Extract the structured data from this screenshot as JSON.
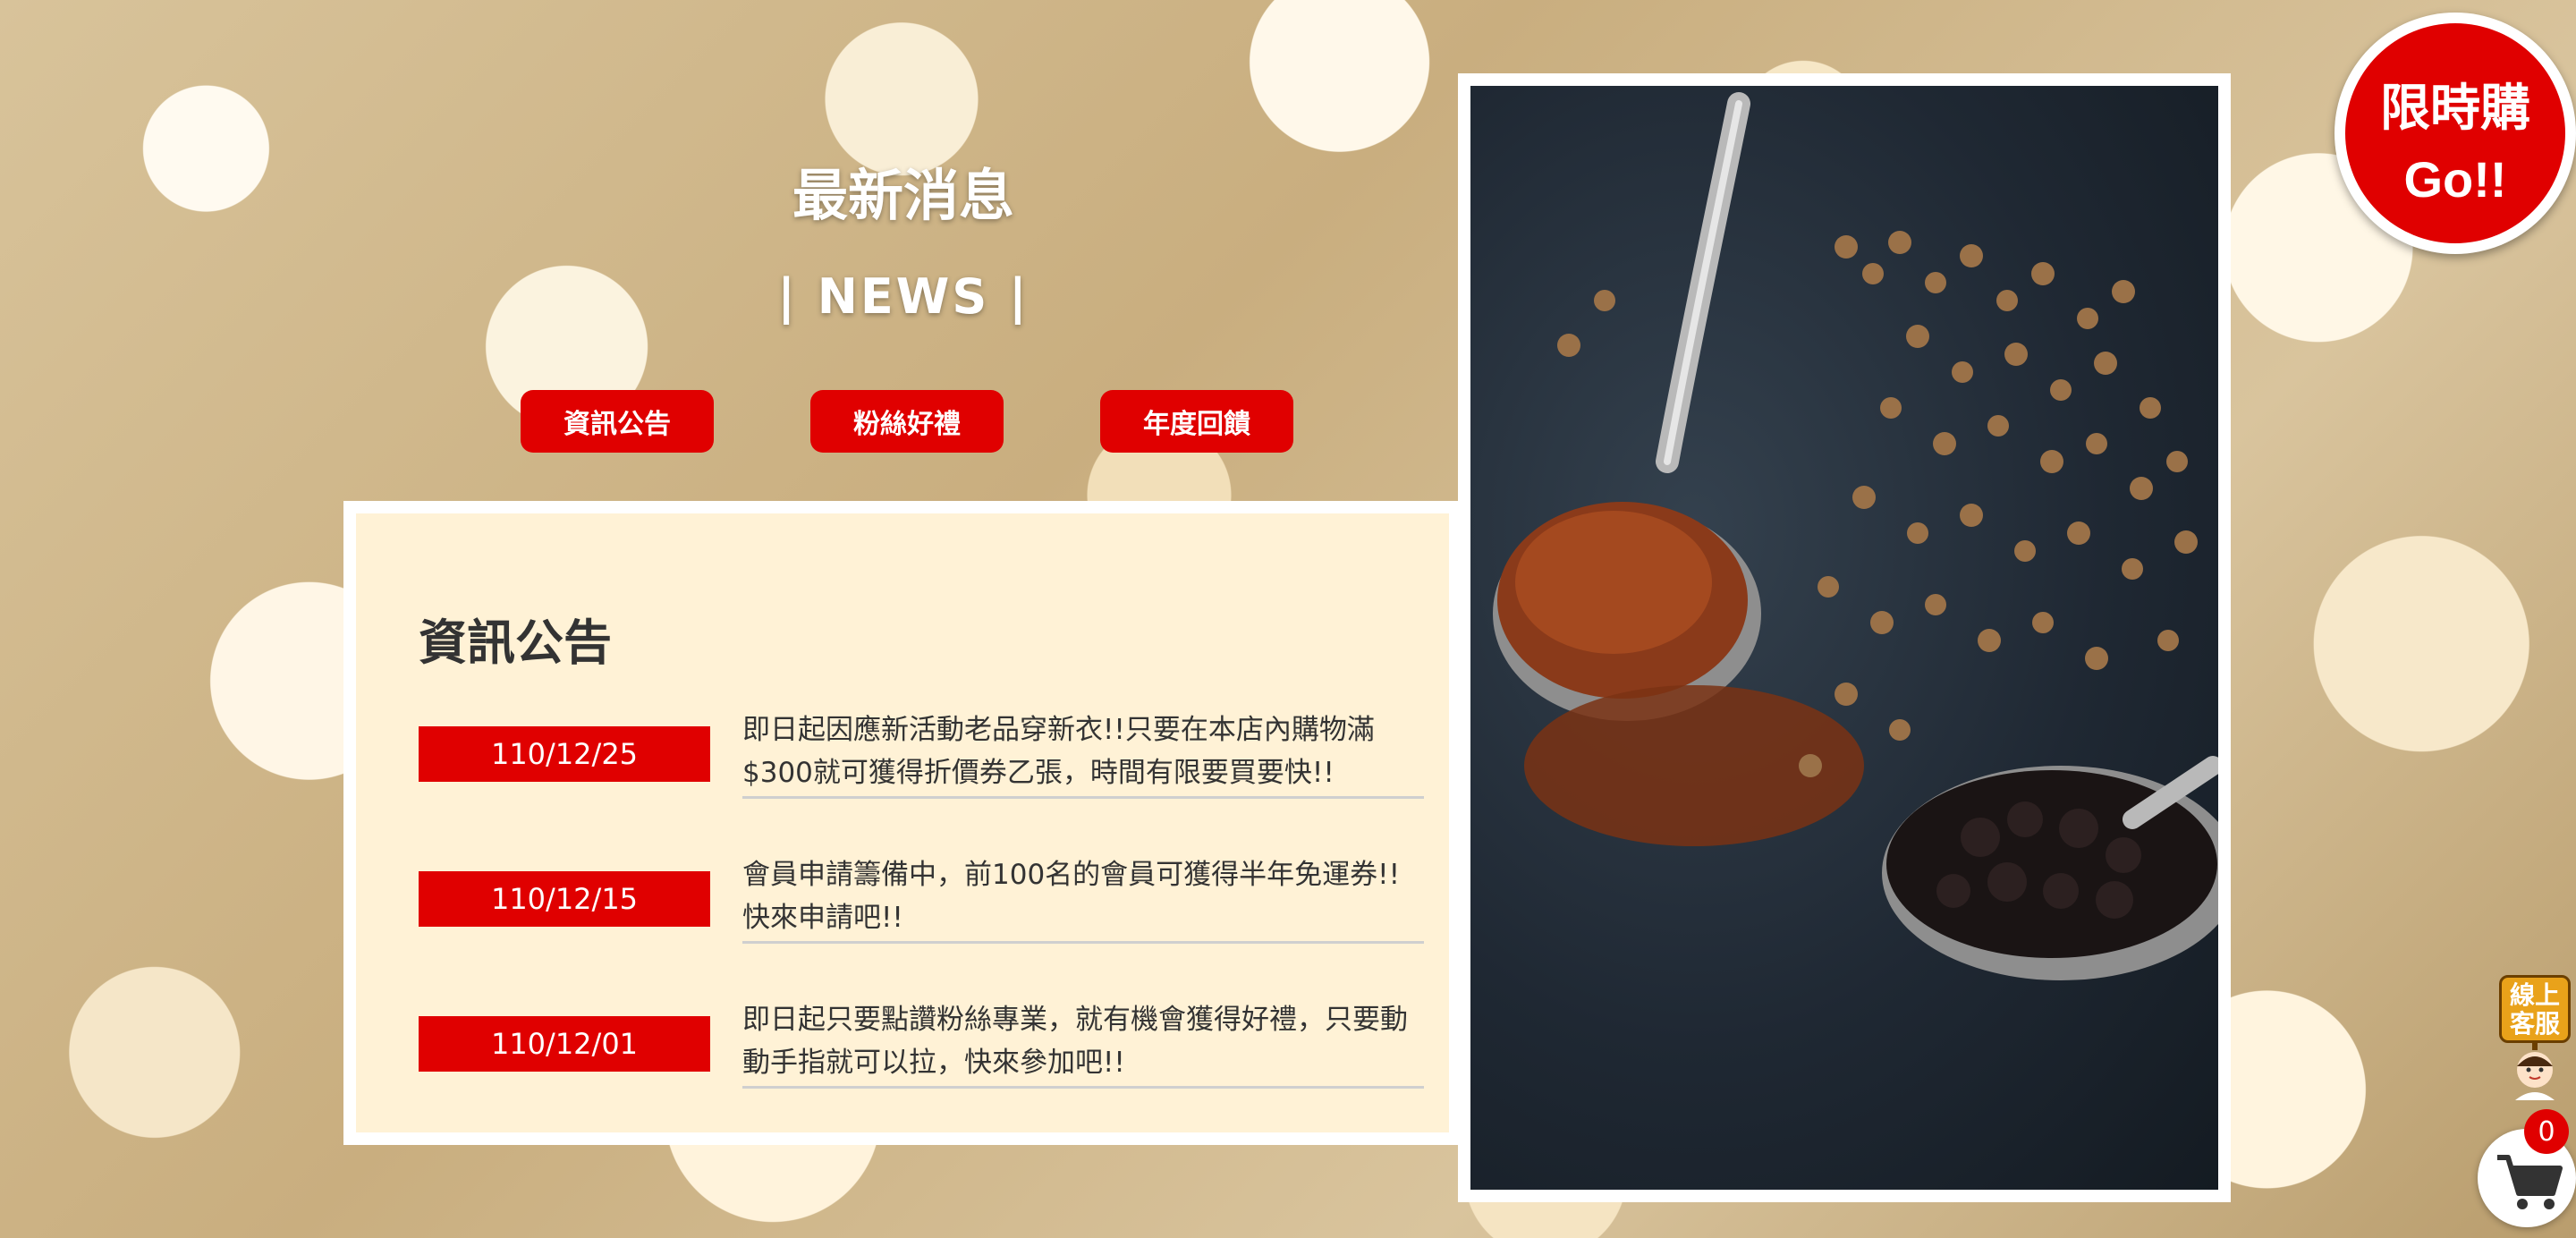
{
  "news_section": {
    "title": "最新消息",
    "subtitle": "| NEWS |",
    "tabs": [
      {
        "label": "資訊公告"
      },
      {
        "label": "粉絲好禮"
      },
      {
        "label": "年度回饋"
      }
    ]
  },
  "panel": {
    "title": "資訊公告",
    "items": [
      {
        "date": "110/12/25",
        "text": "即日起因應新活動老品穿新衣!!只要在本店內購物滿$300就可獲得折價券乙張，時間有限要買要快!!"
      },
      {
        "date": "110/12/15",
        "text": "會員申請籌備中，前100名的會員可獲得半年免運券!! 快來申請吧!!"
      },
      {
        "date": "110/12/01",
        "text": "即日起只要點讚粉絲專業，就有機會獲得好禮，只要動動手指就可以拉，快來參加吧!!"
      }
    ]
  },
  "flash_sale": {
    "line1": "限時購",
    "line2": "Go!!"
  },
  "customer_service": {
    "label": "線上客服"
  },
  "cart": {
    "count": "0"
  },
  "colors": {
    "accent": "#e00000",
    "panel_bg": "#fff2d6"
  }
}
